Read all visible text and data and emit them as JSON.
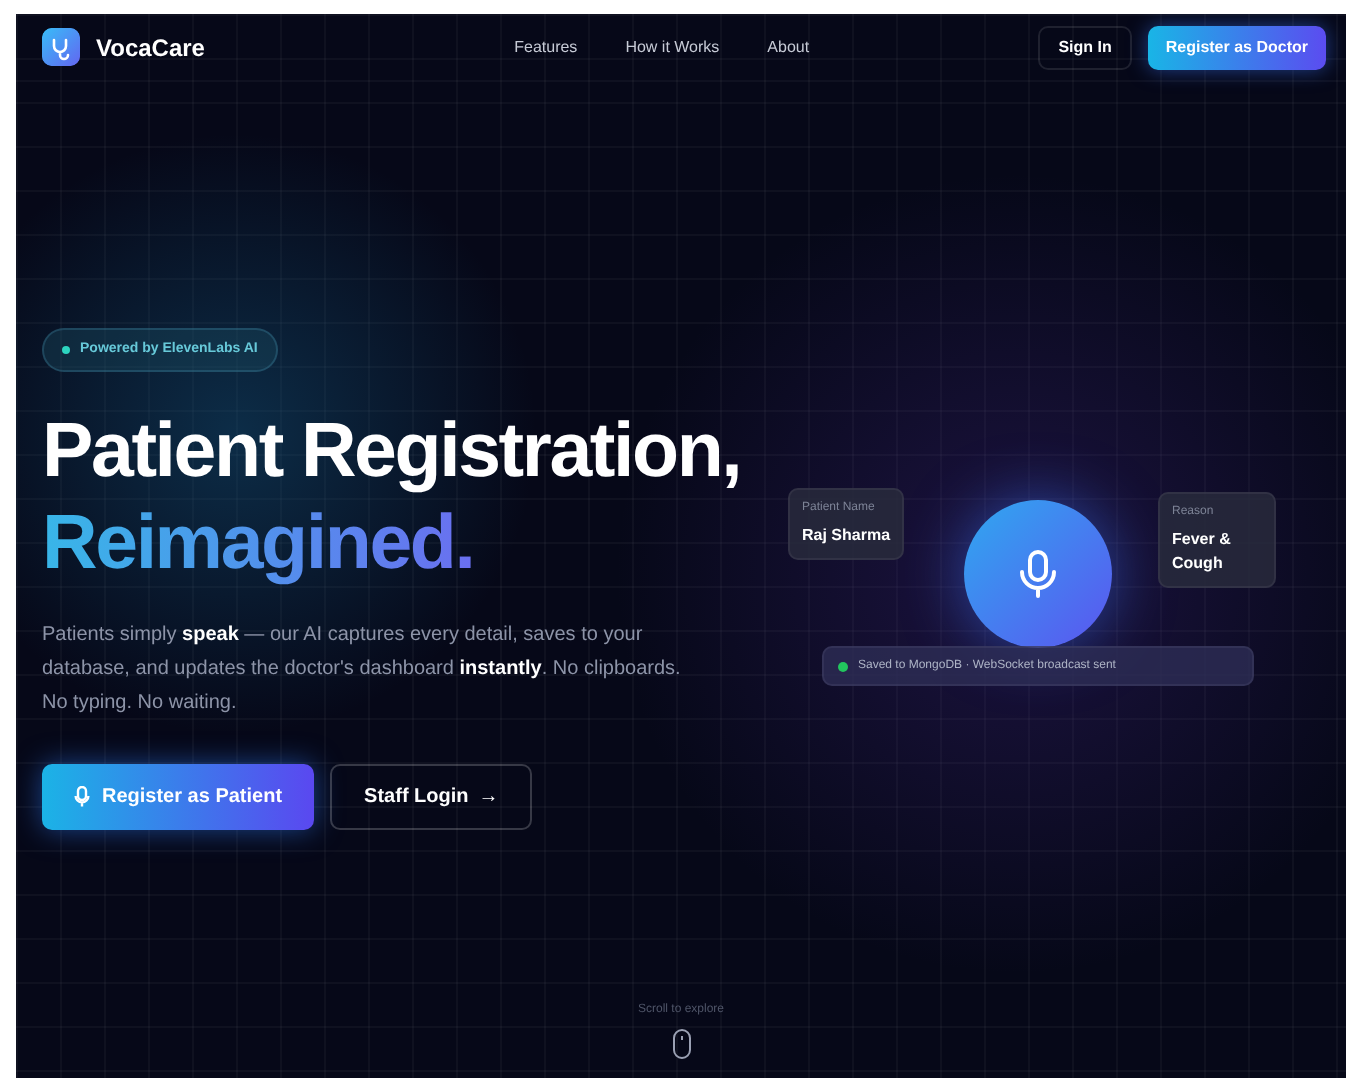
{
  "nav": {
    "brand": "VocaCare",
    "links": [
      "Features",
      "How it Works",
      "About"
    ],
    "sign_in": "Sign In",
    "register": "Register as Doctor"
  },
  "hero": {
    "badge": "Powered by ElevenLabs AI",
    "title_line1": "Patient Registration,",
    "title_line2": "Reimagined.",
    "description": "Patients simply **speak** — our AI captures every detail, saves to your database, and updates the doctor's dashboard **instantly**. No clipboards. No typing. No waiting.",
    "primary_button": "Register as Patient",
    "secondary_button": {
      "label": "Staff Login",
      "arrow": "→"
    }
  },
  "visual": {
    "cards": [
      {
        "label": "Patient Name",
        "value": "Raj Sharma"
      },
      {
        "label": "Reason",
        "value": "Fever & Cough"
      }
    ],
    "status": "Saved to MongoDB · WebSocket broadcast sent"
  },
  "scroll_hint": "Scroll to explore"
}
